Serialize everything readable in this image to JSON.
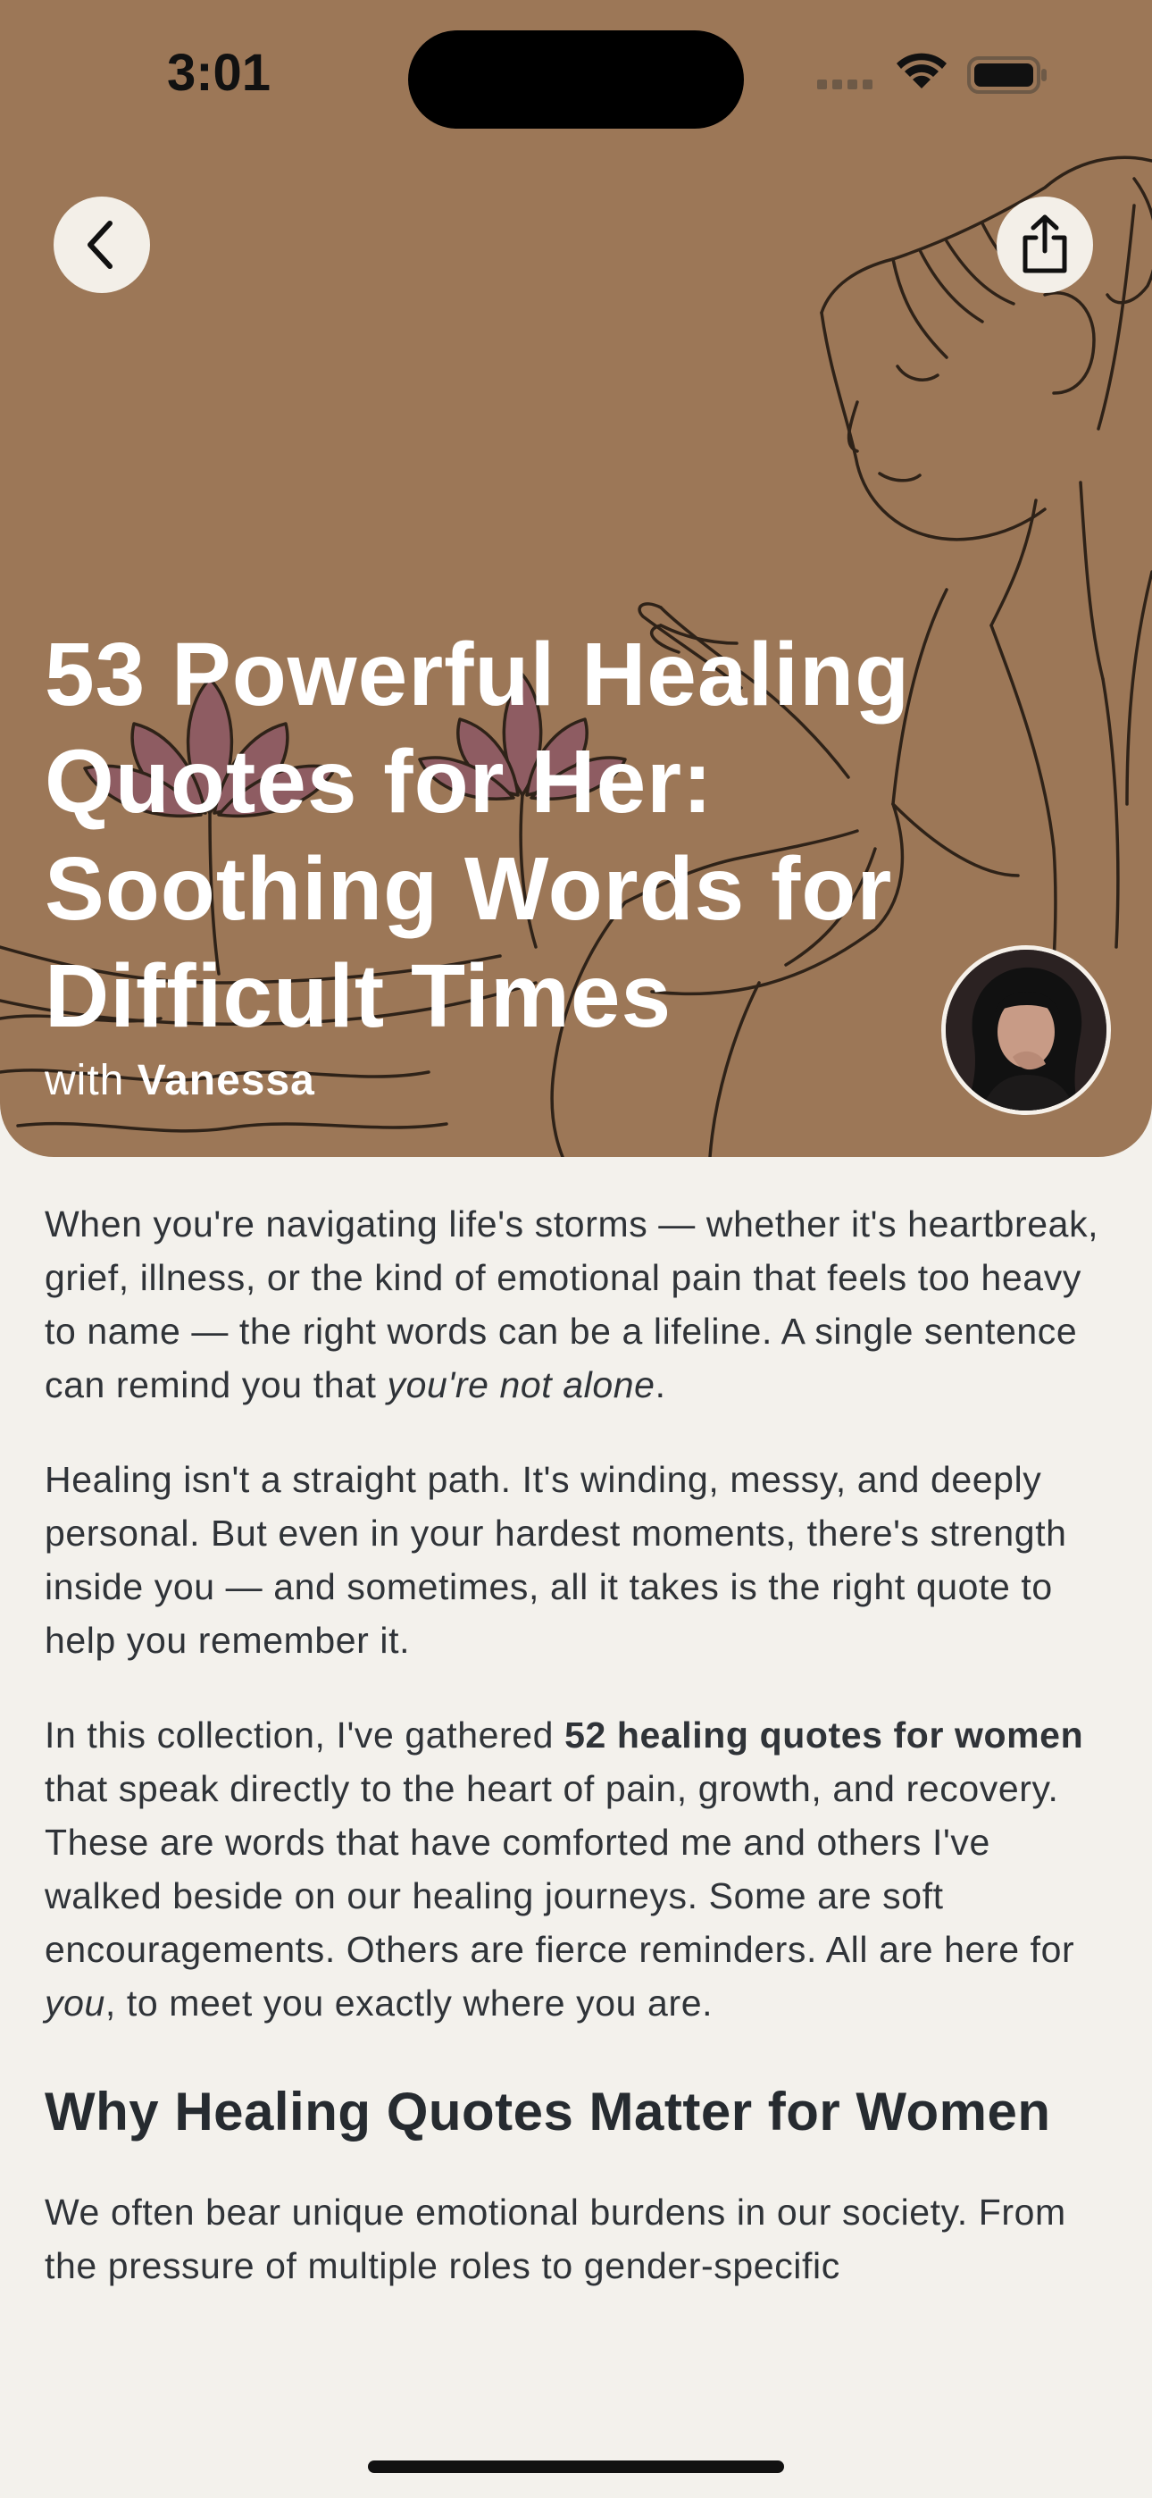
{
  "status_bar": {
    "time": "3:01"
  },
  "header": {
    "back_icon": "chevron-left-icon",
    "share_icon": "share-icon",
    "title": "53 Powerful Healing Quotes for Her: Soothing Words for Difficult Times",
    "byline_prefix": "with",
    "author": "Vanessa",
    "background_color": "#9c7757"
  },
  "article": {
    "paragraph_1": {
      "text": "When you're navigating life's storms — whether it's heartbreak, grief, illness, or the kind of emotional pain that feels too heavy to name — the right words can be a lifeline. A single sentence can remind you that ",
      "emphasis": "you're not alone",
      "end": "."
    },
    "paragraph_2": "Healing isn't a straight path. It's winding, messy, and deeply personal. But even in your hardest moments, there's strength inside you — and sometimes, all it takes is the right quote to help you remember it.",
    "paragraph_3": {
      "start": "In this collection, I've gathered ",
      "bold": "52 healing quotes for women",
      "middle": " that speak directly to the heart of pain, growth, and recovery. These are words that have comforted me and others I've walked beside on our healing journeys. Some are soft encouragements. Others are fierce reminders. All are here for ",
      "emphasis": "you",
      "end": ", to meet you exactly where you are."
    },
    "heading": "Why Healing Quotes Matter for Women",
    "paragraph_4": "We often bear unique emotional burdens in our society. From the pressure of multiple roles to gender-specific"
  }
}
